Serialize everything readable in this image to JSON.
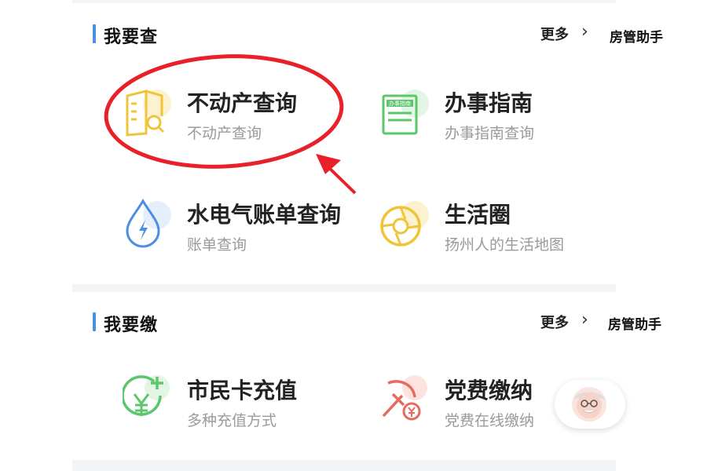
{
  "colors": {
    "accent_bar": "#4a90e2",
    "annotation_red": "#e8202a"
  },
  "query_section": {
    "title": "我要查",
    "more": "更多",
    "helper": "房管助手",
    "tiles": [
      {
        "title": "不动产查询",
        "subtitle": "不动产查询",
        "icon": "property-search-icon"
      },
      {
        "title": "办事指南",
        "subtitle": "办事指南查询",
        "icon": "guide-doc-icon"
      },
      {
        "title": "水电气账单查询",
        "subtitle": "账单查询",
        "icon": "utility-drop-icon"
      },
      {
        "title": "生活圈",
        "subtitle": "扬州人的生活地图",
        "icon": "life-circle-icon"
      }
    ]
  },
  "pay_section": {
    "title": "我要缴",
    "more": "更多",
    "helper": "房管助手",
    "tiles": [
      {
        "title": "市民卡充值",
        "subtitle": "多种充值方式",
        "icon": "card-recharge-icon"
      },
      {
        "title": "党费缴纳",
        "subtitle": "党费在线缴纳",
        "icon": "party-fee-icon"
      }
    ]
  },
  "guide_icon_text": "办事指南",
  "assistant_avatar": "elderly-assistant-icon"
}
